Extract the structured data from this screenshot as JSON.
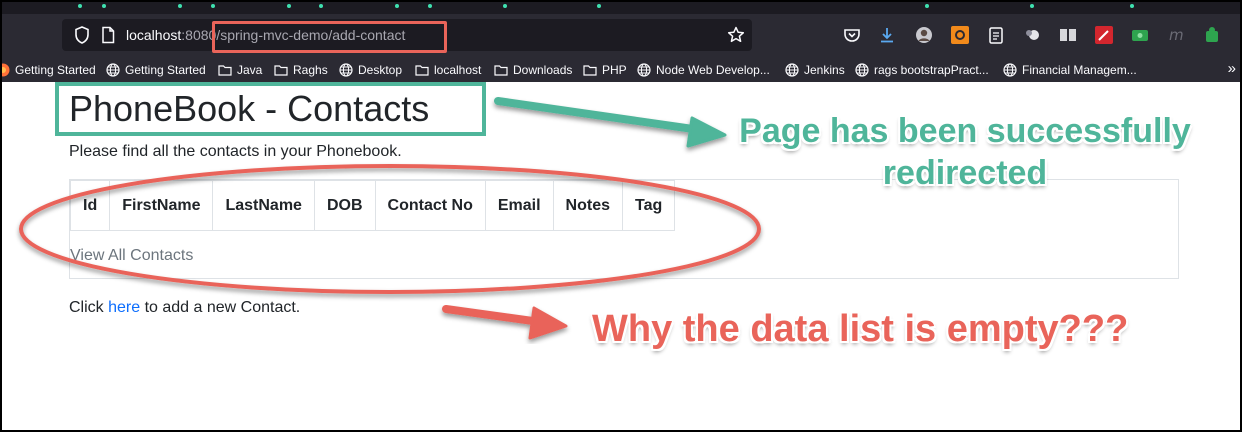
{
  "browser": {
    "url_host": "localhost",
    "url_port_path": ":8080/spring-mvc-demo/add-contact",
    "bookmarks": [
      "Getting Started",
      "Getting Started",
      "Java",
      "Raghs",
      "Desktop",
      "localhost",
      "Downloads",
      "PHP",
      "Node Web Develop...",
      "Jenkins",
      "rags bootstrapPract...",
      "Financial Managem..."
    ],
    "overflow_label": "»"
  },
  "page": {
    "title": "PhoneBook - Contacts",
    "subtitle": "Please find all the contacts in your Phonebook.",
    "table_headers": [
      "Id",
      "FirstName",
      "LastName",
      "DOB",
      "Contact No",
      "Email",
      "Notes",
      "Tag"
    ],
    "view_all_link": "View All Contacts",
    "add_prefix": "Click ",
    "add_link": "here",
    "add_suffix": " to add a new Contact."
  },
  "annotations": {
    "redirected_note": "Page has been successfully redirected",
    "empty_note": "Why the data list is empty???",
    "green": "#4fb59a",
    "red": "#e9645a"
  }
}
